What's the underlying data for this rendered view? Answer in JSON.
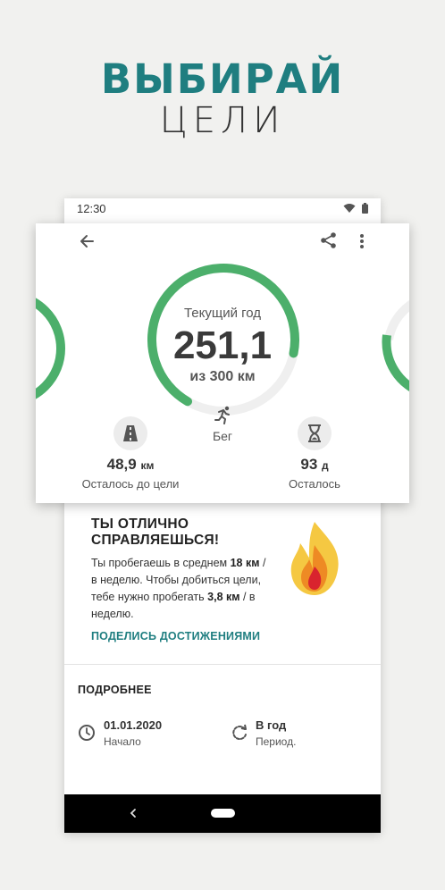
{
  "promo": {
    "line1": "ВЫБИРАЙ",
    "line2": "ЦЕЛИ"
  },
  "status_bar": {
    "time": "12:30"
  },
  "goal": {
    "period_label": "Текущий год",
    "value": "251,1",
    "target": "из 300 км",
    "sport": "Бег",
    "progress": 0.837
  },
  "stats": {
    "remaining_distance": {
      "value": "48,9",
      "unit": "км",
      "label": "Осталось до цели"
    },
    "remaining_days": {
      "value": "93",
      "unit": "д",
      "label": "Осталось"
    }
  },
  "motivation": {
    "title": "ТЫ ОТЛИЧНО СПРАВЛЯЕШЬСЯ!",
    "text_1": "Ты пробегаешь в среднем ",
    "avg_value": "18 км",
    "text_2": " / в неделю. Чтобы добиться цели, тебе нужно пробегать ",
    "need_value": "3,8 км",
    "text_3": " / в неделю.",
    "share_label": "ПОДЕЛИСЬ ДОСТИЖЕНИЯМИ"
  },
  "details": {
    "heading": "ПОДРОБНЕЕ",
    "start": {
      "value": "01.01.2020",
      "label": "Начало"
    },
    "period": {
      "value": "В год",
      "label": "Период."
    }
  },
  "colors": {
    "accent": "#1f7e80",
    "ring": "#4caf6b",
    "ring_bg": "#efefef"
  }
}
